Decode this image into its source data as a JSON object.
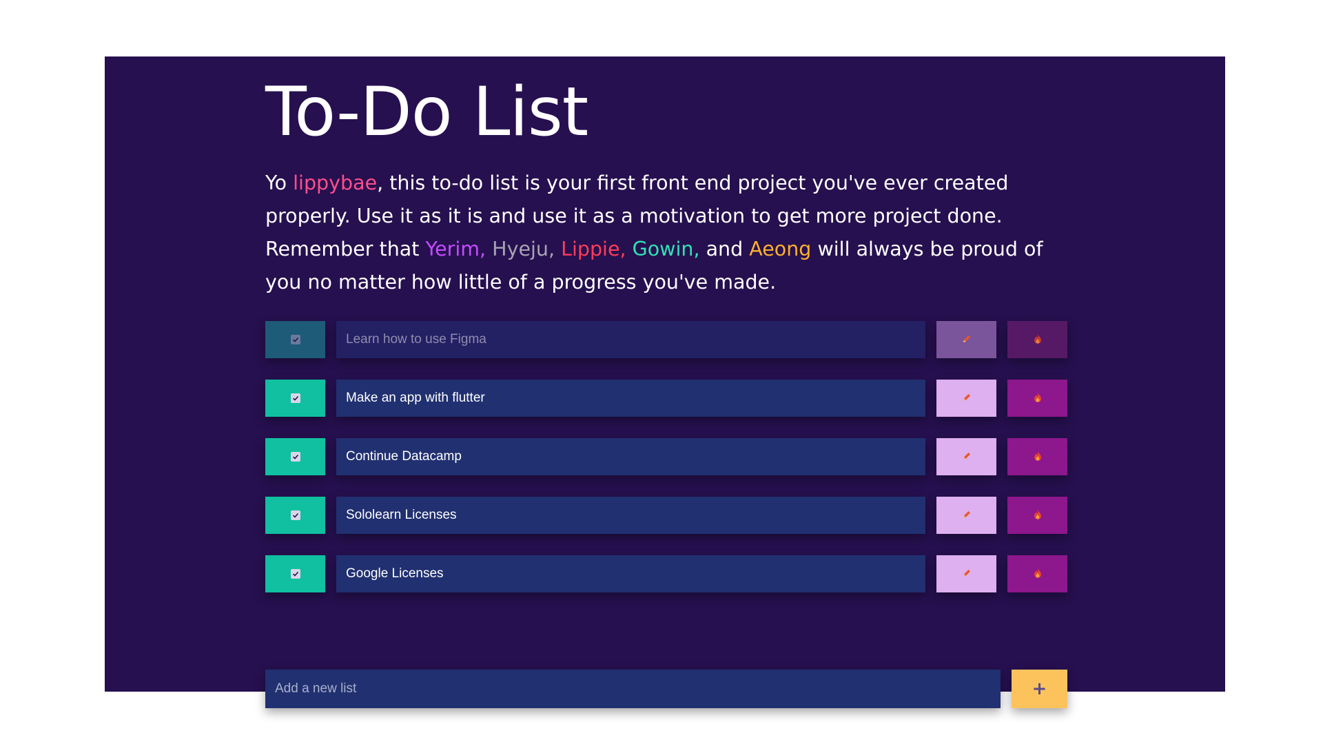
{
  "header": {
    "title": "To-Do List"
  },
  "intro": {
    "part1": "Yo ",
    "name": "lippybae",
    "part2": ", this to-do list is your first front end project you've ever created properly. Use it as it is and use it as a motivation to get more project done. Remember that ",
    "name_yerim": "Yerim,",
    "name_hyeju": "Hyeju,",
    "name_lippie": "Lippie,",
    "name_gowin": "Gowin,",
    "and": "and",
    "name_aeong": "Aeong",
    "part3": "will always be proud of you no matter how little of a progress you've made."
  },
  "tasks": [
    {
      "text": "Learn how to use Figma",
      "done": true,
      "dimmed": true
    },
    {
      "text": "Make an app with flutter",
      "done": true,
      "dimmed": false
    },
    {
      "text": "Continue Datacamp",
      "done": true,
      "dimmed": false
    },
    {
      "text": "Sololearn Licenses",
      "done": true,
      "dimmed": false
    },
    {
      "text": "Google Licenses",
      "done": true,
      "dimmed": false
    }
  ],
  "add_form": {
    "placeholder": "Add a new list",
    "button_label": "+"
  },
  "icons": {
    "check": "checkbox-check-icon",
    "edit": "pencil-icon",
    "delete": "fire-icon"
  },
  "colors": {
    "background": "#26104f",
    "check": "#10c0a0",
    "task_bg": "#213070",
    "edit": "#deb0ef",
    "delete": "#8d178c",
    "add": "#fcc35c",
    "name_highlight": "#ff4d8d"
  }
}
